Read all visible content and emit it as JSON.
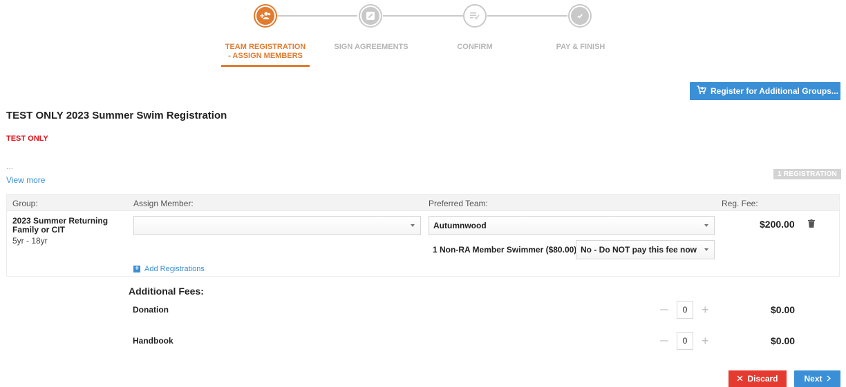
{
  "stepper": {
    "steps": [
      {
        "label": "TEAM REGISTRATION\n- ASSIGN MEMBERS",
        "line1": "TEAM REGISTRATION",
        "line2": "- ASSIGN MEMBERS",
        "icon": "add-users-icon",
        "active": true
      },
      {
        "label": "SIGN AGREEMENTS",
        "icon": "pen-square-icon",
        "active": false
      },
      {
        "label": "CONFIRM",
        "icon": "list-check-icon",
        "active": false
      },
      {
        "label": "PAY & FINISH",
        "icon": "check-circle-icon",
        "active": false
      }
    ]
  },
  "actions": {
    "register_additional_label": "Register for Additional Groups...",
    "discard_label": "Discard",
    "next_label": "Next"
  },
  "event": {
    "title": "TEST ONLY 2023 Summer Swim Registration",
    "tag": "TEST ONLY",
    "ellipsis": "...",
    "view_more": "View more",
    "registration_count": "1 REGISTRATION"
  },
  "table": {
    "headers": {
      "group": "Group:",
      "assign_member": "Assign Member:",
      "preferred_team": "Preferred Team:",
      "reg_fee": "Reg. Fee:"
    },
    "row": {
      "group_name": "2023 Summer Returning Family or CIT",
      "age_range": "5yr - 18yr",
      "assign_member_value": "",
      "preferred_team_value": "Autumnwood",
      "fee": "$200.00",
      "option_fee_label": "1 Non-RA Member Swimmer ($80.00)",
      "option_fee_value": "No - Do NOT pay this fee now",
      "add_registrations": "Add Registrations"
    }
  },
  "additional_fees": {
    "title": "Additional Fees:",
    "items": [
      {
        "name": "Donation",
        "qty": "0",
        "amount": "$0.00"
      },
      {
        "name": "Handbook",
        "qty": "0",
        "amount": "$0.00"
      }
    ]
  },
  "colors": {
    "accent": "#e07b2f",
    "primary": "#3b8fd6",
    "danger": "#e43a2f",
    "tag": "#e3121b"
  }
}
